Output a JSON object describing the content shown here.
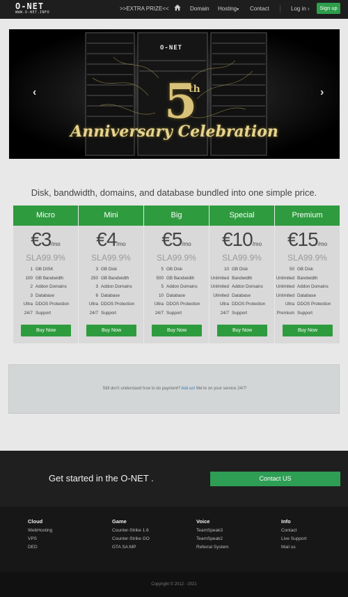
{
  "nav": {
    "logo_text": "O-NET",
    "logo_sub": "WWW.O-NET.INFO",
    "extra_prize": ">>EXTRA PRIZE<<",
    "domain": "Domain",
    "hosting": "Hosting",
    "hosting_caret": "▾",
    "contact": "Contact",
    "login": "Log in",
    "login_arrow": "›",
    "signup": "Sign up"
  },
  "banner": {
    "logo": "O-NET",
    "number": "5",
    "suffix": "th",
    "caption": "Anniversary Celebration",
    "prev": "‹",
    "next": "›"
  },
  "pricing": {
    "headline": "Disk, bandwidth, domains, and database bundled into one simple price.",
    "plans": [
      {
        "name": "Micro",
        "price": "€3",
        "per": "/mo",
        "sla": "SLA99.9%",
        "buy": "Buy Now",
        "features": [
          [
            "1",
            "GB DISK"
          ],
          [
            "100",
            "GB Bandwidth"
          ],
          [
            "2",
            "Addon Domains"
          ],
          [
            "3",
            "Database"
          ],
          [
            "Ultra",
            "DDOS Protection"
          ],
          [
            "24/7",
            "Support"
          ]
        ]
      },
      {
        "name": "Mini",
        "price": "€4",
        "per": "/mo",
        "sla": "SLA99.9%",
        "buy": "Buy Now",
        "features": [
          [
            "3",
            "GB Disk"
          ],
          [
            "250",
            "GB Bandwidth"
          ],
          [
            "3",
            "Addon Domains"
          ],
          [
            "6",
            "Database"
          ],
          [
            "Ultra",
            "DDOS Protection"
          ],
          [
            "24/7",
            "Support"
          ]
        ]
      },
      {
        "name": "Big",
        "price": "€5",
        "per": "/mo",
        "sla": "SLA99.9%",
        "buy": "Buy Now",
        "features": [
          [
            "5",
            "GB Disk"
          ],
          [
            "500",
            "GB Bandwidth"
          ],
          [
            "5",
            "Addon Domains"
          ],
          [
            "10",
            "Database"
          ],
          [
            "Ultra",
            "DDOS Protection"
          ],
          [
            "24/7",
            "Support"
          ]
        ]
      },
      {
        "name": "Special",
        "price": "€10",
        "per": "/mo",
        "sla": "SLA99.9%",
        "buy": "Buy Now",
        "features": [
          [
            "10",
            "GB Disk"
          ],
          [
            "Unlimited",
            "Bandwidth"
          ],
          [
            "Unlimited",
            "Addon Domains"
          ],
          [
            "Ulimited",
            "Database"
          ],
          [
            "Ultra",
            "DDOS Protection"
          ],
          [
            "24/7",
            "Support"
          ]
        ]
      },
      {
        "name": "Premium",
        "price": "€15",
        "per": "/mo",
        "sla": "SLA99.9%",
        "buy": "Buy Now",
        "features": [
          [
            "50",
            "GB Disk"
          ],
          [
            "Unlimited",
            "Bandwidth"
          ],
          [
            "Unlimited",
            "Addon Domains"
          ],
          [
            "Unlimited",
            "Database"
          ],
          [
            "Ultra",
            "DDOS Protection"
          ],
          [
            "Premium",
            "Support"
          ]
        ]
      }
    ]
  },
  "info": {
    "before": "Still don't understand how to do payment? ",
    "link": "Ask us!",
    "after": " We're on your service 24/7!"
  },
  "cta": {
    "text": "Get started in the O-NET .",
    "button": "Contact US"
  },
  "footer": {
    "columns": [
      {
        "title": "Cloud",
        "links": [
          "WebHosting",
          "VPS",
          "DED"
        ]
      },
      {
        "title": "Game",
        "links": [
          "Counter-Strike 1.6",
          "Counter-Strike GO",
          "GTA SA:MP"
        ]
      },
      {
        "title": "Voice",
        "links": [
          "TeamSpeak3",
          "TeamSpeak2",
          "Referral System"
        ]
      },
      {
        "title": "Info",
        "links": [
          "Contact",
          "Live Support",
          "Mail us"
        ]
      }
    ],
    "copyright": "Copyright © 2012 - 2021"
  },
  "colors": {
    "accent_green": "#2f9b3f",
    "navbar_bg": "#1e1e1e",
    "footer_bg": "#171717",
    "link_blue": "#2a6fb0"
  },
  "icons": {
    "home": "home-icon",
    "prev": "chevron-left-icon",
    "next": "chevron-right-icon"
  }
}
